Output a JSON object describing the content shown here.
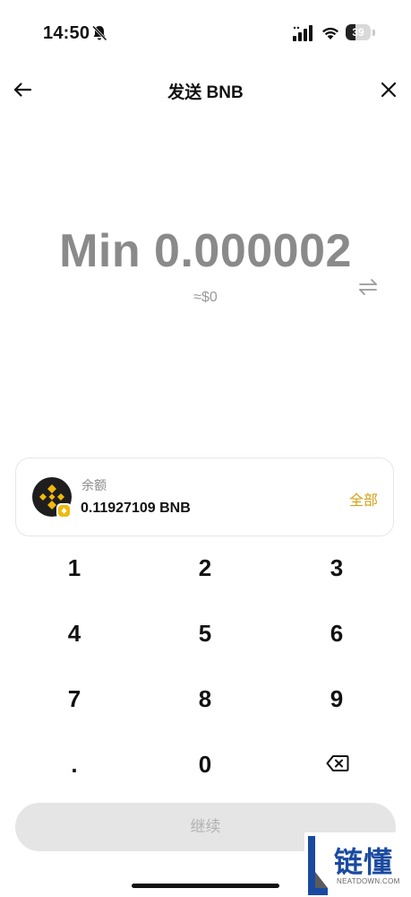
{
  "status_bar": {
    "time": "14:50",
    "battery_level": "39",
    "battery_fraction": 0.39,
    "icons": [
      "bell-muted-icon",
      "signal-icon",
      "wifi-icon",
      "battery-icon"
    ]
  },
  "header": {
    "title": "发送 BNB",
    "back_icon": "arrow-left-icon",
    "close_icon": "close-icon"
  },
  "amount": {
    "display": "Min 0.000002",
    "fiat": "≈$0",
    "swap_icon": "swap-arrows-icon"
  },
  "balance": {
    "label": "余额",
    "value": "0.11927109 BNB",
    "max_label": "全部",
    "token_icon": "bnb-logo-icon"
  },
  "keypad": {
    "keys": [
      "1",
      "2",
      "3",
      "4",
      "5",
      "6",
      "7",
      "8",
      "9",
      ".",
      "0",
      "⌫"
    ]
  },
  "continue_label": "继续",
  "colors": {
    "accent": "#D4A11A",
    "amount_text": "#8A8A8A",
    "button_disabled_bg": "#E5E5E5",
    "button_disabled_text": "#B2B2B2",
    "bnb_yellow": "#F0B90B"
  },
  "watermark": {
    "text": "链懂",
    "sub": "NEATDOWN.COM"
  }
}
